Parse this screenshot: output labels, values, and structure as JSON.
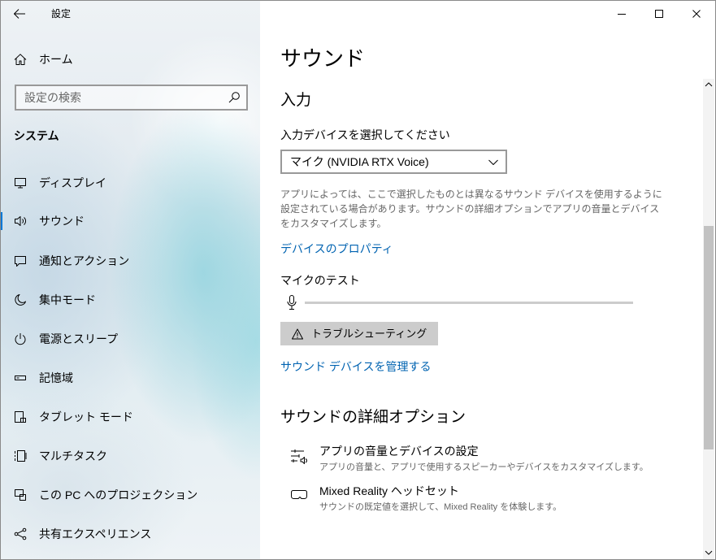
{
  "window": {
    "title": "設定",
    "controls": [
      "minimize-icon",
      "maximize-icon",
      "close-icon"
    ]
  },
  "sidebar": {
    "back_icon": "back-arrow-icon",
    "home": {
      "label": "ホーム",
      "icon": "home-icon"
    },
    "search": {
      "placeholder": "設定の検索",
      "icon": "search-icon"
    },
    "section_title": "システム",
    "items": [
      {
        "label": "ディスプレイ",
        "icon": "display-icon",
        "selected": false
      },
      {
        "label": "サウンド",
        "icon": "speaker-icon",
        "selected": true
      },
      {
        "label": "通知とアクション",
        "icon": "notification-icon",
        "selected": false
      },
      {
        "label": "集中モード",
        "icon": "moon-icon",
        "selected": false
      },
      {
        "label": "電源とスリープ",
        "icon": "power-icon",
        "selected": false
      },
      {
        "label": "記憶域",
        "icon": "storage-icon",
        "selected": false
      },
      {
        "label": "タブレット モード",
        "icon": "tablet-icon",
        "selected": false
      },
      {
        "label": "マルチタスク",
        "icon": "multitasking-icon",
        "selected": false
      },
      {
        "label": "この PC へのプロジェクション",
        "icon": "projection-icon",
        "selected": false
      },
      {
        "label": "共有エクスペリエンス",
        "icon": "shared-experiences-icon",
        "selected": false
      }
    ]
  },
  "main": {
    "title": "サウンド",
    "input": {
      "heading": "入力",
      "device_prompt": "入力デバイスを選択してください",
      "selected_device": "マイク (NVIDIA RTX Voice)",
      "description": "アプリによっては、ここで選択したものとは異なるサウンド デバイスを使用するように設定されている場合があります。サウンドの詳細オプションでアプリの音量とデバイスをカスタマイズします。",
      "properties_link": "デバイスのプロパティ",
      "mic_test_label": "マイクのテスト",
      "mic_level": 0,
      "troubleshoot_button": "トラブルシューティング",
      "troubleshoot_icon": "warning-icon",
      "manage_devices_link": "サウンド デバイスを管理する"
    },
    "advanced": {
      "heading": "サウンドの詳細オプション",
      "items": [
        {
          "title": "アプリの音量とデバイスの設定",
          "description": "アプリの音量と、アプリで使用するスピーカーやデバイスをカスタマイズします。",
          "icon": "app-volume-icon"
        },
        {
          "title": "Mixed Reality ヘッドセット",
          "description": "サウンドの既定値を選択して、Mixed Reality を体験します。",
          "icon": "vr-headset-icon"
        }
      ]
    }
  },
  "colors": {
    "accent": "#0078d7",
    "link": "#0063b1",
    "secondary_text": "#666666"
  }
}
